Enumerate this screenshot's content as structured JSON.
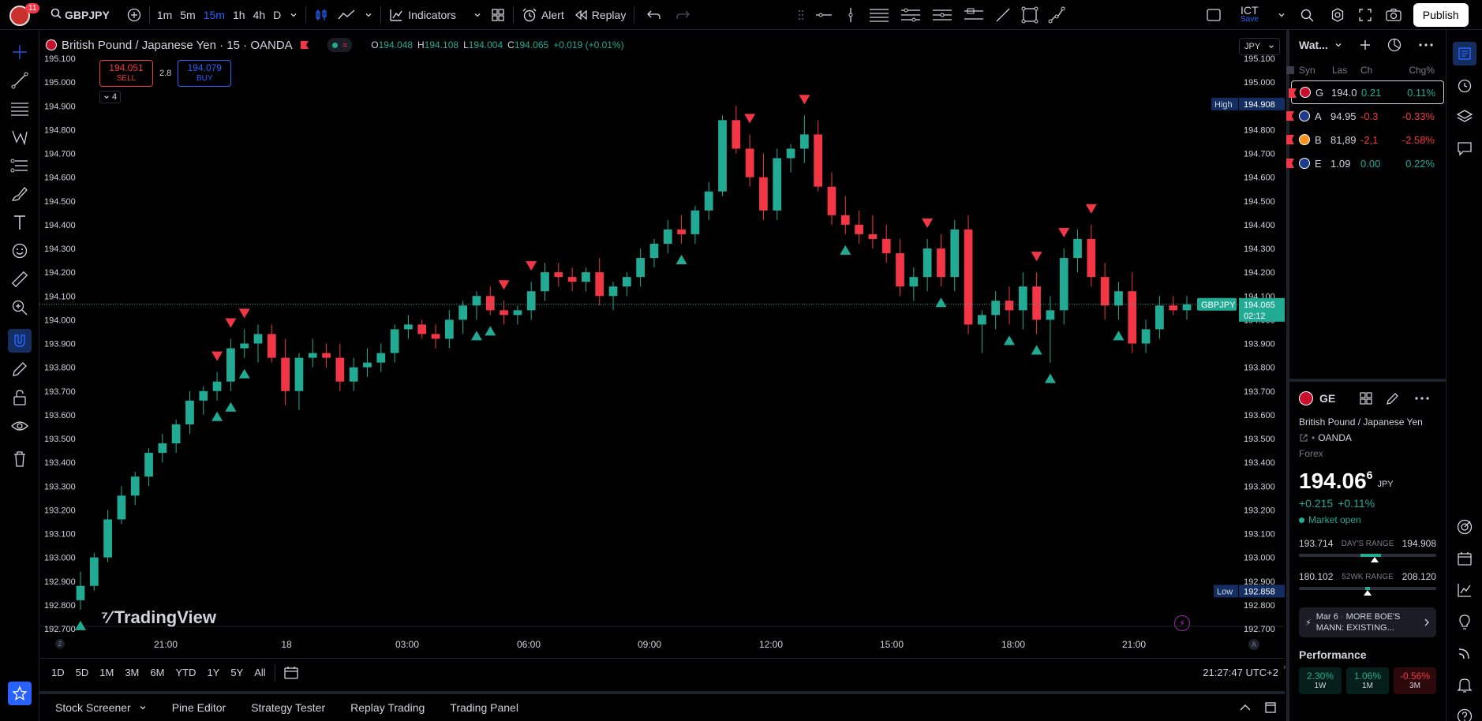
{
  "topbar": {
    "notification_count": "11",
    "symbol": "GBPJPY",
    "intervals": [
      "1m",
      "5m",
      "15m",
      "1h",
      "4h",
      "D"
    ],
    "active_interval": "15m",
    "indicators_label": "Indicators",
    "alert_label": "Alert",
    "replay_label": "Replay",
    "layout_name": "ICT",
    "layout_sub": "Save",
    "publish_label": "Publish"
  },
  "legend": {
    "title": "British Pound / Japanese Yen · 15 · OANDA",
    "o_label": "O",
    "o": "194.048",
    "h_label": "H",
    "h": "194.108",
    "l_label": "L",
    "l": "194.004",
    "c_label": "C",
    "c": "194.065",
    "change": "+0.019 (+0.01%)",
    "sell_price": "194.051",
    "sell_label": "SELL",
    "spread": "2.8",
    "buy_price": "194.079",
    "buy_label": "BUY",
    "collapse_count": "4",
    "currency": "JPY"
  },
  "price_axis": [
    "195.100",
    "195.000",
    "194.900",
    "194.800",
    "194.700",
    "194.600",
    "194.500",
    "194.400",
    "194.300",
    "194.200",
    "194.100",
    "194.000",
    "193.900",
    "193.800",
    "193.700",
    "193.600",
    "193.500",
    "193.400",
    "193.300",
    "193.200",
    "193.100",
    "193.000",
    "192.900",
    "192.800",
    "192.700"
  ],
  "axis_badges": {
    "high_label": "High",
    "high_value": "194.908",
    "low_label": "Low",
    "low_value": "192.858",
    "symbol_label": "GBPJPY",
    "last_value": "194.065",
    "countdown": "02:12"
  },
  "time_axis": [
    {
      "label": "21:00"
    },
    {
      "label": "18"
    },
    {
      "label": "03:00"
    },
    {
      "label": "06:00"
    },
    {
      "label": "09:00"
    },
    {
      "label": "12:00"
    },
    {
      "label": "15:00"
    },
    {
      "label": "18:00"
    },
    {
      "label": "21:00"
    }
  ],
  "axis_corner_left": "Z",
  "axis_corner_right": "A",
  "watermark": "TradingView",
  "timebar": {
    "ranges": [
      "1D",
      "5D",
      "1M",
      "3M",
      "6M",
      "YTD",
      "1Y",
      "5Y",
      "All"
    ],
    "clock": "21:27:47 UTC+2"
  },
  "bottom_tabs": [
    "Stock Screener",
    "Pine Editor",
    "Strategy Tester",
    "Replay Trading",
    "Trading Panel"
  ],
  "watchlist": {
    "title": "Wat...",
    "columns": [
      "Syn",
      "Las",
      "Ch",
      "Chg%"
    ],
    "rows": [
      {
        "sym": "G",
        "last": "194.0",
        "chg": "0.21",
        "pct": "0.11%",
        "dir": "up",
        "icon_color": "#c8102e"
      },
      {
        "sym": "A",
        "last": "94.95",
        "chg": "-0.3",
        "pct": "-0.33%",
        "dir": "down",
        "icon_color": "#1e3a8a"
      },
      {
        "sym": "B",
        "last": "81,89",
        "chg": "-2,1",
        "pct": "-2.58%",
        "dir": "down",
        "icon_color": "#f7931a"
      },
      {
        "sym": "E",
        "last": "1.09",
        "chg": "0.00",
        "pct": "0.22%",
        "dir": "up",
        "icon_color": "#1e3a8a"
      }
    ]
  },
  "details": {
    "symbol_short": "GE",
    "name": "British Pound / Japanese Yen",
    "exchange": "OANDA",
    "category": "Forex",
    "price_main": "194.06",
    "price_sup": "6",
    "price_currency": "JPY",
    "change": "+0.215",
    "change_pct": "+0.11%",
    "market_status": "Market open",
    "day_low": "193.714",
    "day_label": "DAY'S RANGE",
    "day_high": "194.908",
    "day_position": 0.55,
    "wk_low": "180.102",
    "wk_label": "52WK RANGE",
    "wk_high": "208.120",
    "wk_position": 0.5,
    "news_date": "Mar 6",
    "news_text": "MORE BOE'S MANN: EXISTING...",
    "performance_label": "Performance",
    "performance": [
      {
        "value": "2.30%",
        "period": "1W",
        "dir": "up"
      },
      {
        "value": "1.06%",
        "period": "1M",
        "dir": "up"
      },
      {
        "value": "-0.56%",
        "period": "3M",
        "dir": "down"
      }
    ]
  },
  "colors": {
    "up": "#22ab94",
    "down": "#f23645",
    "accent": "#2962ff"
  },
  "chart_data": {
    "type": "candlestick",
    "symbol": "GBPJPY",
    "interval": "15",
    "ylim": [
      192.65,
      195.15
    ],
    "candles": [
      [
        192.82,
        192.94,
        192.78,
        192.88
      ],
      [
        192.88,
        193.02,
        192.86,
        193.0
      ],
      [
        193.0,
        193.2,
        192.98,
        193.16
      ],
      [
        193.16,
        193.3,
        193.14,
        193.26
      ],
      [
        193.26,
        193.36,
        193.22,
        193.34
      ],
      [
        193.34,
        193.46,
        193.3,
        193.44
      ],
      [
        193.44,
        193.52,
        193.4,
        193.48
      ],
      [
        193.48,
        193.58,
        193.44,
        193.56
      ],
      [
        193.56,
        193.7,
        193.52,
        193.66
      ],
      [
        193.66,
        193.72,
        193.6,
        193.7
      ],
      [
        193.7,
        193.78,
        193.66,
        193.74
      ],
      [
        193.74,
        193.92,
        193.7,
        193.88
      ],
      [
        193.88,
        193.96,
        193.84,
        193.9
      ],
      [
        193.9,
        193.98,
        193.82,
        193.94
      ],
      [
        193.94,
        193.98,
        193.82,
        193.84
      ],
      [
        193.84,
        193.92,
        193.64,
        193.7
      ],
      [
        193.7,
        193.86,
        193.62,
        193.84
      ],
      [
        193.84,
        193.92,
        193.8,
        193.86
      ],
      [
        193.86,
        193.9,
        193.8,
        193.84
      ],
      [
        193.84,
        193.9,
        193.7,
        193.74
      ],
      [
        193.74,
        193.84,
        193.7,
        193.8
      ],
      [
        193.8,
        193.88,
        193.76,
        193.82
      ],
      [
        193.82,
        193.9,
        193.78,
        193.86
      ],
      [
        193.86,
        193.98,
        193.82,
        193.96
      ],
      [
        193.96,
        194.02,
        193.92,
        193.98
      ],
      [
        193.98,
        194.0,
        193.92,
        193.94
      ],
      [
        193.94,
        193.98,
        193.88,
        193.92
      ],
      [
        193.92,
        194.04,
        193.88,
        194.0
      ],
      [
        194.0,
        194.08,
        193.94,
        194.06
      ],
      [
        194.06,
        194.12,
        194.0,
        194.1
      ],
      [
        194.1,
        194.14,
        194.02,
        194.04
      ],
      [
        194.04,
        194.08,
        193.98,
        194.02
      ],
      [
        194.02,
        194.06,
        193.98,
        194.04
      ],
      [
        194.04,
        194.16,
        194.0,
        194.12
      ],
      [
        194.12,
        194.24,
        194.08,
        194.2
      ],
      [
        194.2,
        194.24,
        194.14,
        194.18
      ],
      [
        194.18,
        194.22,
        194.12,
        194.16
      ],
      [
        194.16,
        194.22,
        194.12,
        194.2
      ],
      [
        194.2,
        194.26,
        194.06,
        194.1
      ],
      [
        194.1,
        194.16,
        194.04,
        194.14
      ],
      [
        194.14,
        194.2,
        194.1,
        194.18
      ],
      [
        194.18,
        194.3,
        194.14,
        194.26
      ],
      [
        194.26,
        194.34,
        194.22,
        194.32
      ],
      [
        194.32,
        194.42,
        194.28,
        194.38
      ],
      [
        194.38,
        194.44,
        194.32,
        194.36
      ],
      [
        194.36,
        194.48,
        194.32,
        194.46
      ],
      [
        194.46,
        194.58,
        194.42,
        194.54
      ],
      [
        194.54,
        194.86,
        194.52,
        194.84
      ],
      [
        194.84,
        194.9,
        194.7,
        194.72
      ],
      [
        194.72,
        194.78,
        194.56,
        194.6
      ],
      [
        194.6,
        194.7,
        194.42,
        194.46
      ],
      [
        194.46,
        194.72,
        194.42,
        194.68
      ],
      [
        194.68,
        194.74,
        194.62,
        194.72
      ],
      [
        194.72,
        194.86,
        194.66,
        194.78
      ],
      [
        194.78,
        194.84,
        194.54,
        194.56
      ],
      [
        194.56,
        194.62,
        194.4,
        194.44
      ],
      [
        194.44,
        194.52,
        194.36,
        194.4
      ],
      [
        194.4,
        194.46,
        194.32,
        194.36
      ],
      [
        194.36,
        194.44,
        194.3,
        194.34
      ],
      [
        194.34,
        194.4,
        194.24,
        194.28
      ],
      [
        194.28,
        194.34,
        194.1,
        194.14
      ],
      [
        194.14,
        194.22,
        194.08,
        194.18
      ],
      [
        194.18,
        194.34,
        194.12,
        194.3
      ],
      [
        194.3,
        194.36,
        194.14,
        194.18
      ],
      [
        194.18,
        194.42,
        194.12,
        194.38
      ],
      [
        194.38,
        194.44,
        193.94,
        193.98
      ],
      [
        193.98,
        194.04,
        193.86,
        194.02
      ],
      [
        194.02,
        194.12,
        193.96,
        194.08
      ],
      [
        194.08,
        194.14,
        193.98,
        194.04
      ],
      [
        194.04,
        194.2,
        193.96,
        194.14
      ],
      [
        194.14,
        194.2,
        193.94,
        194.0
      ],
      [
        194.0,
        194.1,
        193.82,
        194.04
      ],
      [
        194.04,
        194.3,
        193.98,
        194.26
      ],
      [
        194.26,
        194.38,
        194.2,
        194.34
      ],
      [
        194.34,
        194.4,
        194.14,
        194.18
      ],
      [
        194.18,
        194.24,
        194.0,
        194.06
      ],
      [
        194.06,
        194.16,
        194.0,
        194.12
      ],
      [
        194.12,
        194.2,
        193.86,
        193.9
      ],
      [
        193.9,
        194.0,
        193.86,
        193.96
      ],
      [
        193.96,
        194.1,
        193.92,
        194.06
      ],
      [
        194.06,
        194.1,
        194.02,
        194.04
      ],
      [
        194.04,
        194.1,
        194.0,
        194.065
      ]
    ],
    "buy_signal_indices": [
      0,
      10,
      11,
      12,
      29,
      30,
      44,
      56,
      63,
      68,
      70,
      71,
      76
    ],
    "sell_signal_indices": [
      10,
      11,
      12,
      31,
      33,
      49,
      53,
      62,
      70,
      72,
      74
    ]
  }
}
